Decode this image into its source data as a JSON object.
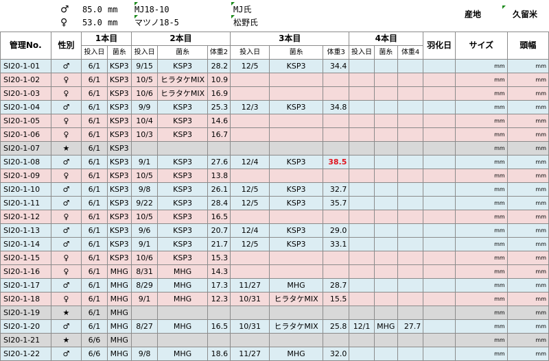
{
  "header": {
    "male_symbol": "♂",
    "female_symbol": "♀",
    "male_size": "85.0",
    "female_size": "53.0",
    "unit": "mm",
    "male_line": "MJ18-10",
    "female_line": "マツノ18-5",
    "male_breeder": "MJ氏",
    "female_breeder": "松野氏",
    "origin_label": "産地",
    "origin_value": "久留米"
  },
  "columns": {
    "id": "管理No.",
    "sex": "性別",
    "bottle1": "1本目",
    "bottle2": "2本目",
    "bottle3": "3本目",
    "bottle4": "4本目",
    "eclosion": "羽化日",
    "size": "サイズ",
    "head": "頭幅",
    "input_date": "投入日",
    "substrate": "菌糸",
    "weight2": "体重2",
    "weight3": "体重3",
    "weight4": "体重4"
  },
  "unit_mm": "mm",
  "rows": [
    {
      "id": "SI20-1-01",
      "sex": "♂",
      "kind": "male",
      "d1": "6/1",
      "s1": "KSP3",
      "d2": "9/15",
      "s2": "KSP3",
      "w2": "28.2",
      "d3": "12/5",
      "s3": "KSP3",
      "w3": "34.4",
      "d4": "",
      "s4": "",
      "w4": ""
    },
    {
      "id": "SI20-1-02",
      "sex": "♀",
      "kind": "female",
      "d1": "6/1",
      "s1": "KSP3",
      "d2": "10/5",
      "s2": "ヒラタケMIX",
      "w2": "10.9",
      "d3": "",
      "s3": "",
      "w3": "",
      "d4": "",
      "s4": "",
      "w4": ""
    },
    {
      "id": "SI20-1-03",
      "sex": "♀",
      "kind": "female",
      "d1": "6/1",
      "s1": "KSP3",
      "d2": "10/6",
      "s2": "ヒラタケMIX",
      "w2": "16.9",
      "d3": "",
      "s3": "",
      "w3": "",
      "d4": "",
      "s4": "",
      "w4": ""
    },
    {
      "id": "SI20-1-04",
      "sex": "♂",
      "kind": "male",
      "d1": "6/1",
      "s1": "KSP3",
      "d2": "9/9",
      "s2": "KSP3",
      "w2": "25.3",
      "d3": "12/3",
      "s3": "KSP3",
      "w3": "34.8",
      "d4": "",
      "s4": "",
      "w4": ""
    },
    {
      "id": "SI20-1-05",
      "sex": "♀",
      "kind": "female",
      "d1": "6/1",
      "s1": "KSP3",
      "d2": "10/4",
      "s2": "KSP3",
      "w2": "14.6",
      "d3": "",
      "s3": "",
      "w3": "",
      "d4": "",
      "s4": "",
      "w4": ""
    },
    {
      "id": "SI20-1-06",
      "sex": "♀",
      "kind": "female",
      "d1": "6/1",
      "s1": "KSP3",
      "d2": "10/3",
      "s2": "KSP3",
      "w2": "16.7",
      "d3": "",
      "s3": "",
      "w3": "",
      "d4": "",
      "s4": "",
      "w4": ""
    },
    {
      "id": "SI20-1-07",
      "sex": "★",
      "kind": "star",
      "d1": "6/1",
      "s1": "KSP3",
      "d2": "",
      "s2": "",
      "w2": "",
      "d3": "",
      "s3": "",
      "w3": "",
      "d4": "",
      "s4": "",
      "w4": ""
    },
    {
      "id": "SI20-1-08",
      "sex": "♂",
      "kind": "male",
      "d1": "6/1",
      "s1": "KSP3",
      "d2": "9/1",
      "s2": "KSP3",
      "w2": "27.6",
      "d3": "12/4",
      "s3": "KSP3",
      "w3": "38.5",
      "w3red": true,
      "d4": "",
      "s4": "",
      "w4": ""
    },
    {
      "id": "SI20-1-09",
      "sex": "♀",
      "kind": "female",
      "d1": "6/1",
      "s1": "KSP3",
      "d2": "10/5",
      "s2": "KSP3",
      "w2": "13.8",
      "d3": "",
      "s3": "",
      "w3": "",
      "d4": "",
      "s4": "",
      "w4": ""
    },
    {
      "id": "SI20-1-10",
      "sex": "♂",
      "kind": "male",
      "d1": "6/1",
      "s1": "KSP3",
      "d2": "9/8",
      "s2": "KSP3",
      "w2": "26.1",
      "d3": "12/5",
      "s3": "KSP3",
      "w3": "32.7",
      "d4": "",
      "s4": "",
      "w4": ""
    },
    {
      "id": "SI20-1-11",
      "sex": "♂",
      "kind": "male",
      "d1": "6/1",
      "s1": "KSP3",
      "d2": "9/22",
      "s2": "KSP3",
      "w2": "28.4",
      "d3": "12/5",
      "s3": "KSP3",
      "w3": "35.7",
      "d4": "",
      "s4": "",
      "w4": ""
    },
    {
      "id": "SI20-1-12",
      "sex": "♀",
      "kind": "female",
      "d1": "6/1",
      "s1": "KSP3",
      "d2": "10/5",
      "s2": "KSP3",
      "w2": "16.5",
      "d3": "",
      "s3": "",
      "w3": "",
      "d4": "",
      "s4": "",
      "w4": ""
    },
    {
      "id": "SI20-1-13",
      "sex": "♂",
      "kind": "male",
      "d1": "6/1",
      "s1": "KSP3",
      "d2": "9/6",
      "s2": "KSP3",
      "w2": "20.7",
      "d3": "12/4",
      "s3": "KSP3",
      "w3": "29.0",
      "d4": "",
      "s4": "",
      "w4": ""
    },
    {
      "id": "SI20-1-14",
      "sex": "♂",
      "kind": "male",
      "d1": "6/1",
      "s1": "KSP3",
      "d2": "9/1",
      "s2": "KSP3",
      "w2": "21.7",
      "d3": "12/5",
      "s3": "KSP3",
      "w3": "33.1",
      "d4": "",
      "s4": "",
      "w4": ""
    },
    {
      "id": "SI20-1-15",
      "sex": "♀",
      "kind": "female",
      "d1": "6/1",
      "s1": "KSP3",
      "d2": "10/6",
      "s2": "KSP3",
      "w2": "15.3",
      "d3": "",
      "s3": "",
      "w3": "",
      "d4": "",
      "s4": "",
      "w4": ""
    },
    {
      "id": "SI20-1-16",
      "sex": "♀",
      "kind": "female",
      "d1": "6/1",
      "s1": "MHG",
      "d2": "8/31",
      "s2": "MHG",
      "w2": "14.3",
      "d3": "",
      "s3": "",
      "w3": "",
      "d4": "",
      "s4": "",
      "w4": ""
    },
    {
      "id": "SI20-1-17",
      "sex": "♂",
      "kind": "male",
      "d1": "6/1",
      "s1": "MHG",
      "d2": "8/29",
      "s2": "MHG",
      "w2": "17.3",
      "d3": "11/27",
      "s3": "MHG",
      "w3": "28.7",
      "d4": "",
      "s4": "",
      "w4": ""
    },
    {
      "id": "SI20-1-18",
      "sex": "♀",
      "kind": "female",
      "d1": "6/1",
      "s1": "MHG",
      "d2": "9/1",
      "s2": "MHG",
      "w2": "12.3",
      "d3": "10/31",
      "s3": "ヒラタケMIX",
      "w3": "15.5",
      "d4": "",
      "s4": "",
      "w4": ""
    },
    {
      "id": "SI20-1-19",
      "sex": "★",
      "kind": "star",
      "d1": "6/1",
      "s1": "MHG",
      "d2": "",
      "s2": "",
      "w2": "",
      "d3": "",
      "s3": "",
      "w3": "",
      "d4": "",
      "s4": "",
      "w4": ""
    },
    {
      "id": "SI20-1-20",
      "sex": "♂",
      "kind": "male",
      "d1": "6/1",
      "s1": "MHG",
      "d2": "8/27",
      "s2": "MHG",
      "w2": "16.5",
      "d3": "10/31",
      "s3": "ヒラタケMIX",
      "w3": "25.8",
      "d4": "12/1",
      "s4": "MHG",
      "w4": "27.7"
    },
    {
      "id": "SI20-1-21",
      "sex": "★",
      "kind": "star",
      "d1": "6/6",
      "s1": "MHG",
      "d2": "",
      "s2": "",
      "w2": "",
      "d3": "",
      "s3": "",
      "w3": "",
      "d4": "",
      "s4": "",
      "w4": ""
    },
    {
      "id": "SI20-1-22",
      "sex": "♂",
      "kind": "male",
      "d1": "6/6",
      "s1": "MHG",
      "d2": "9/8",
      "s2": "MHG",
      "w2": "18.6",
      "d3": "11/27",
      "s3": "MHG",
      "w3": "32.0",
      "d4": "",
      "s4": "",
      "w4": ""
    }
  ]
}
